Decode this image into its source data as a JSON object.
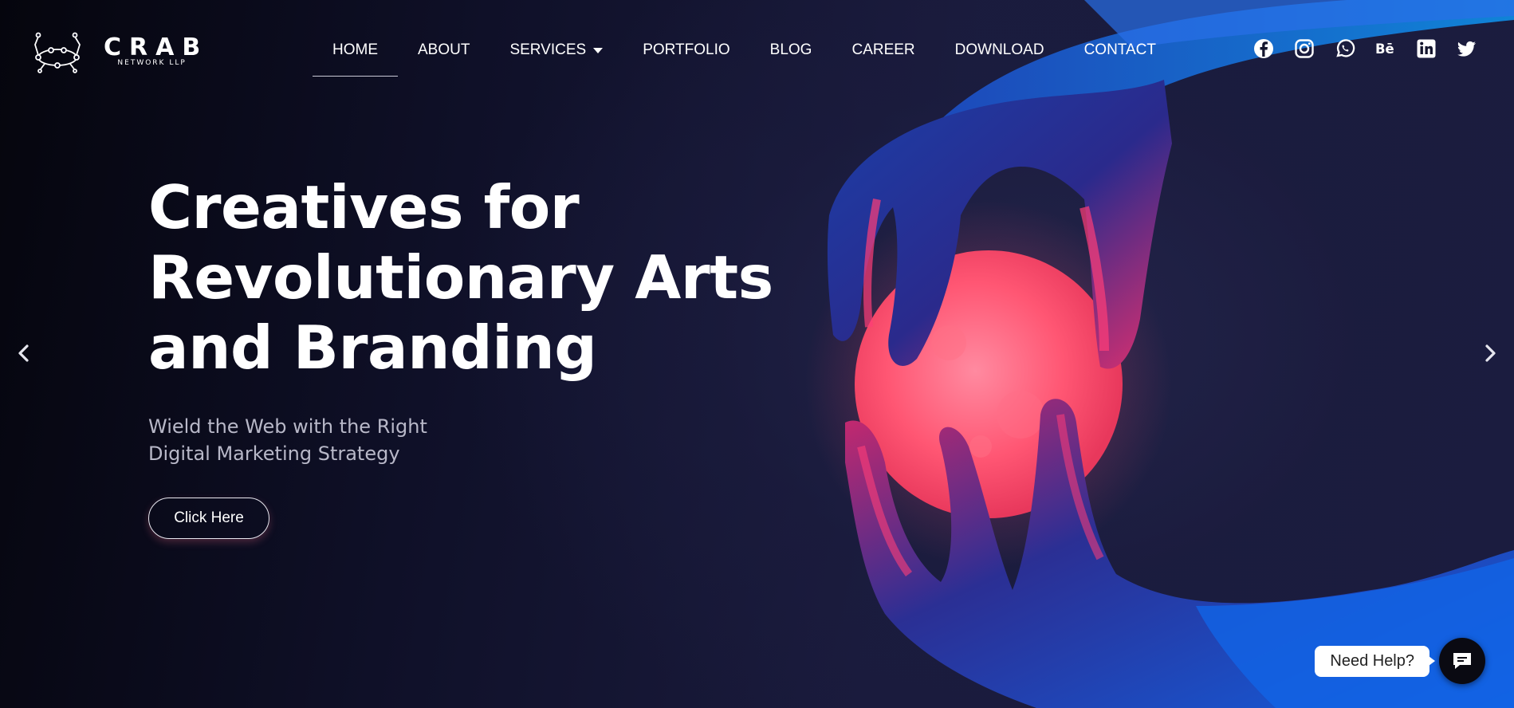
{
  "brand": {
    "name": "CRAB",
    "subtitle": "NETWORK LLP"
  },
  "nav": {
    "items": [
      {
        "label": "HOME",
        "active": true
      },
      {
        "label": "ABOUT"
      },
      {
        "label": "SERVICES",
        "has_dropdown": true
      },
      {
        "label": "PORTFOLIO"
      },
      {
        "label": "BLOG"
      },
      {
        "label": "CAREER"
      },
      {
        "label": "DOWNLOAD"
      },
      {
        "label": "CONTACT"
      }
    ]
  },
  "socials": [
    "facebook-icon",
    "instagram-icon",
    "whatsapp-icon",
    "behance-icon",
    "linkedin-icon",
    "twitter-icon"
  ],
  "hero": {
    "title_line1": "Creatives for",
    "title_line2": "Revolutionary Arts",
    "title_line3": "and Branding",
    "subtitle_line1": "Wield the Web with the Right",
    "subtitle_line2": "Digital Marketing Strategy",
    "cta_label": "Click Here"
  },
  "help": {
    "label": "Need Help?"
  },
  "colors": {
    "background": "#161733",
    "accent_pink": "#ff4d6d",
    "accent_blue": "#1f6ff0"
  }
}
